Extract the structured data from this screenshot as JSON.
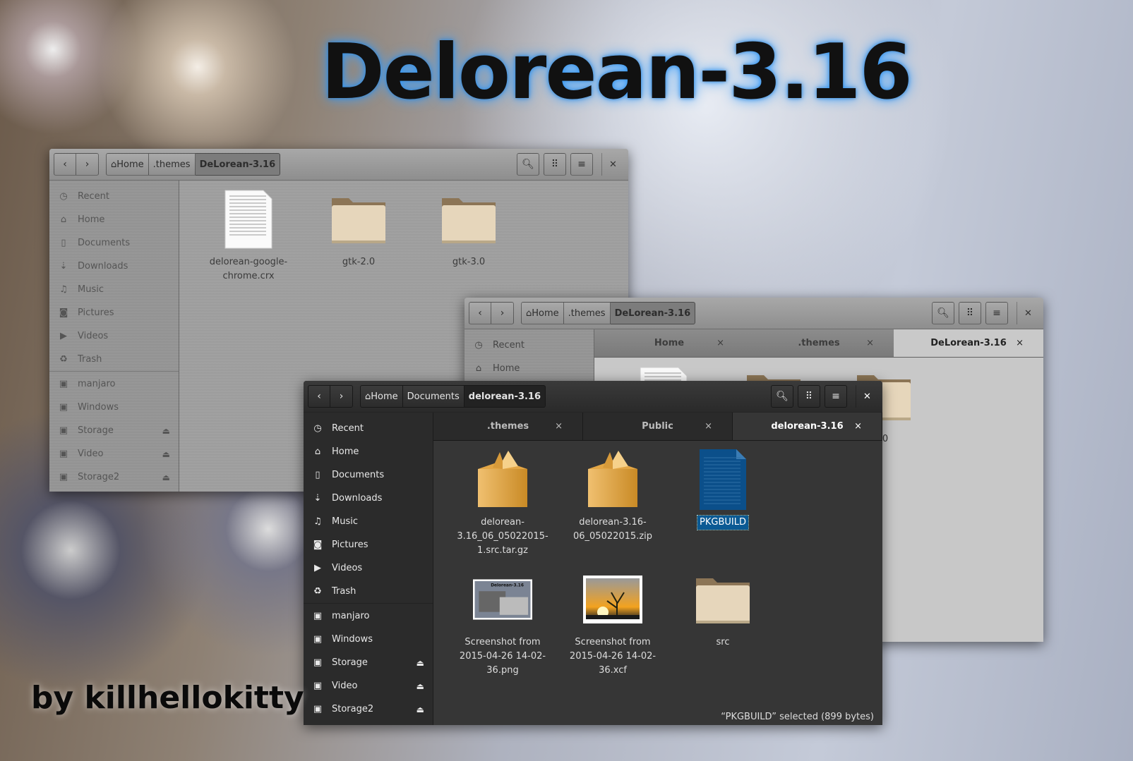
{
  "headline": "Delorean-3.16",
  "credit": "by killhellokitty",
  "icons": {
    "back": "chevron-left-icon",
    "forward": "chevron-right-icon",
    "home": "home-icon",
    "search": "search-icon",
    "view": "grid-view-icon",
    "menu": "hamburger-menu-icon",
    "close": "close-icon",
    "eject": "eject-icon"
  },
  "colors": {
    "selection": "#0b5a94",
    "glow": "#3aa0ff"
  },
  "windows": [
    {
      "id": "w1",
      "theme": "grey",
      "breadcrumb": [
        "Home",
        ".themes",
        "DeLorean-3.16"
      ],
      "sidebar": [
        {
          "label": "Recent",
          "icon": "recent"
        },
        {
          "label": "Home",
          "icon": "home"
        },
        {
          "label": "Documents",
          "icon": "document"
        },
        {
          "label": "Downloads",
          "icon": "download"
        },
        {
          "label": "Music",
          "icon": "music"
        },
        {
          "label": "Pictures",
          "icon": "camera"
        },
        {
          "label": "Videos",
          "icon": "video"
        },
        {
          "label": "Trash",
          "icon": "trash"
        },
        {
          "sep": true
        },
        {
          "label": "manjaro",
          "icon": "drive"
        },
        {
          "label": "Windows",
          "icon": "drive"
        },
        {
          "label": "Storage",
          "icon": "drive",
          "eject": true
        },
        {
          "label": "Video",
          "icon": "drive",
          "eject": true
        },
        {
          "label": "Storage2",
          "icon": "drive",
          "eject": true
        }
      ],
      "tabs": [],
      "files": [
        {
          "name": "delorean-google-chrome.crx",
          "icon": "text"
        },
        {
          "name": "gtk-2.0",
          "icon": "folder"
        },
        {
          "name": "gtk-3.0",
          "icon": "folder"
        }
      ],
      "status": ""
    },
    {
      "id": "w2",
      "theme": "grey",
      "breadcrumb": [
        "Home",
        ".themes",
        "DeLorean-3.16"
      ],
      "sidebar": [
        {
          "label": "Recent",
          "icon": "recent"
        },
        {
          "label": "Home",
          "icon": "home"
        }
      ],
      "tabs": [
        {
          "label": "Home"
        },
        {
          "label": ".themes"
        },
        {
          "label": "DeLorean-3.16",
          "active": true
        }
      ],
      "files": [
        {
          "name": "",
          "icon": "text"
        },
        {
          "name": "",
          "icon": "folder"
        },
        {
          "name": ".0",
          "icon": "folder"
        }
      ],
      "status": ""
    },
    {
      "id": "w3",
      "theme": "dark",
      "breadcrumb": [
        "Home",
        "Documents",
        "delorean-3.16"
      ],
      "sidebar": [
        {
          "label": "Recent",
          "icon": "recent"
        },
        {
          "label": "Home",
          "icon": "home"
        },
        {
          "label": "Documents",
          "icon": "document"
        },
        {
          "label": "Downloads",
          "icon": "download"
        },
        {
          "label": "Music",
          "icon": "music"
        },
        {
          "label": "Pictures",
          "icon": "camera"
        },
        {
          "label": "Videos",
          "icon": "video"
        },
        {
          "label": "Trash",
          "icon": "trash"
        },
        {
          "sep": true
        },
        {
          "label": "manjaro",
          "icon": "drive"
        },
        {
          "label": "Windows",
          "icon": "drive"
        },
        {
          "label": "Storage",
          "icon": "drive",
          "eject": true
        },
        {
          "label": "Video",
          "icon": "drive",
          "eject": true
        },
        {
          "label": "Storage2",
          "icon": "drive",
          "eject": true
        }
      ],
      "tabs": [
        {
          "label": ".themes"
        },
        {
          "label": "Public"
        },
        {
          "label": "delorean-3.16",
          "active": true
        }
      ],
      "files": [
        {
          "name": "delorean-3.16_06_05022015-1.src.tar.gz",
          "icon": "package"
        },
        {
          "name": "delorean-3.16-06_05022015.zip",
          "icon": "package"
        },
        {
          "name": "PKGBUILD",
          "icon": "bluedoc",
          "selected": true
        },
        {
          "name": "Screenshot from 2015-04-26 14-02-36.png",
          "icon": "thumb"
        },
        {
          "name": "Screenshot from 2015-04-26 14-02-36.xcf",
          "icon": "image"
        },
        {
          "name": "src",
          "icon": "folder"
        }
      ],
      "status": "“PKGBUILD” selected  (899 bytes)"
    }
  ]
}
